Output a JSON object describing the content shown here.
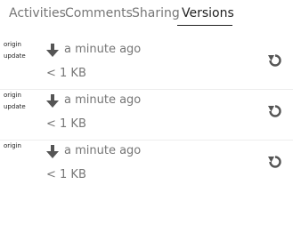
{
  "tabs": [
    {
      "label": "Activities"
    },
    {
      "label": "Comments"
    },
    {
      "label": "Sharing"
    },
    {
      "label": "Versions"
    }
  ],
  "active_tab": "Versions",
  "versions": [
    {
      "thumb_lines": [
        "origin",
        "update"
      ],
      "time": "a minute ago",
      "size": "< 1 KB"
    },
    {
      "thumb_lines": [
        "origin",
        "update"
      ],
      "time": "a minute ago",
      "size": "< 1 KB"
    },
    {
      "thumb_lines": [
        "origin",
        ""
      ],
      "time": "a minute ago",
      "size": "< 1 KB"
    }
  ],
  "icons": {
    "download": "download-arrow-icon",
    "restore": "restore-history-icon"
  },
  "colors": {
    "active_tab": "#222222",
    "inactive_tab": "#767676",
    "meta_text": "#767676",
    "divider": "#ededed",
    "icon": "#555555"
  }
}
